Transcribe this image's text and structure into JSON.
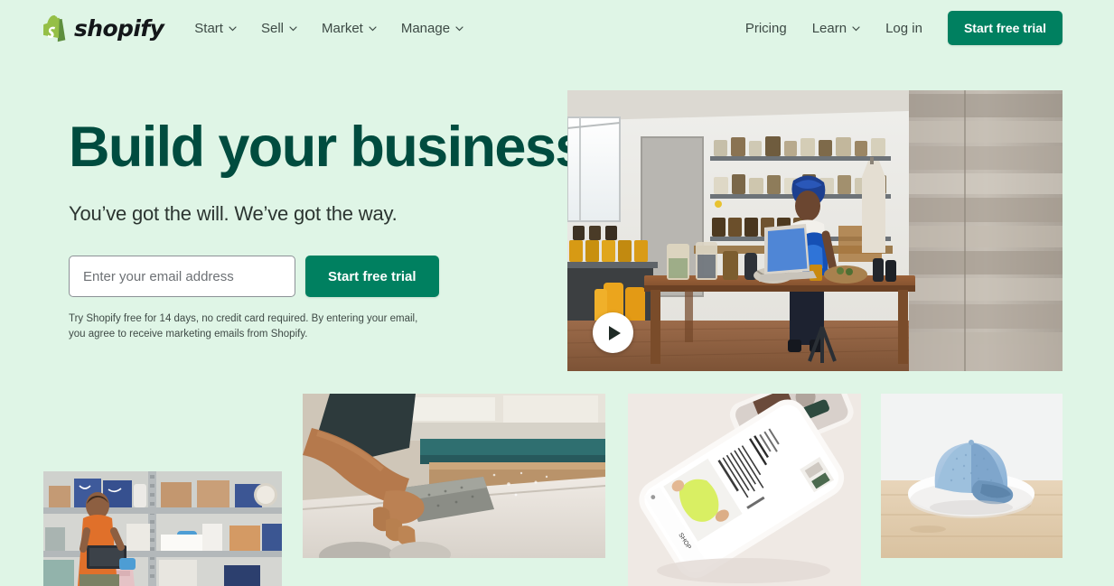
{
  "brand": {
    "logo_icon": "shopify-bag-icon",
    "wordmark": "shopify"
  },
  "nav": {
    "primary": [
      {
        "label": "Start",
        "has_dropdown": true,
        "icon": "chevron-down-icon"
      },
      {
        "label": "Sell",
        "has_dropdown": true,
        "icon": "chevron-down-icon"
      },
      {
        "label": "Market",
        "has_dropdown": true,
        "icon": "chevron-down-icon"
      },
      {
        "label": "Manage",
        "has_dropdown": true,
        "icon": "chevron-down-icon"
      }
    ],
    "secondary": [
      {
        "label": "Pricing",
        "has_dropdown": false
      },
      {
        "label": "Learn",
        "has_dropdown": true,
        "icon": "chevron-down-icon"
      },
      {
        "label": "Log in",
        "has_dropdown": false
      }
    ],
    "cta_label": "Start free trial"
  },
  "hero": {
    "title": "Build your business",
    "subtitle": "You’ve got the will. We’ve got the way.",
    "email_placeholder": "Enter your email address",
    "email_value": "",
    "cta_label": "Start free trial",
    "disclaimer": "Try Shopify free for 14 days, no credit card required. By entering your email, you agree to receive marketing emails from Shopify.",
    "media": {
      "type": "video-thumbnail",
      "play_icon": "play-icon",
      "description": "Woman in blue headwrap working at a wooden table in a shop with jars on wall shelves and a reclaimed wood plank wall"
    }
  },
  "gallery": [
    {
      "name": "warehouse",
      "description": "Person in orange top holding a tablet in front of stocked shelving with boxes"
    },
    {
      "name": "surfboard",
      "description": "Hands sanding a surfboard blank in a workshop"
    },
    {
      "name": "phone",
      "description": "Smartphone on a light surface showing a mobile storefront product page"
    },
    {
      "name": "cap",
      "description": "Light blue baseball cap on a white round plate on a wooden table"
    }
  ],
  "colors": {
    "page_background": "#dff5e6",
    "brand_green": "#008060",
    "heading_green": "#004c3f",
    "logo_green": "#95bf47",
    "text": "#3d4a45"
  }
}
